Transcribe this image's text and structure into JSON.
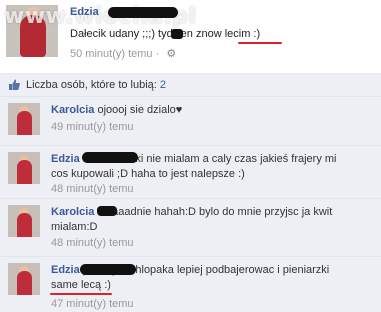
{
  "watermark": "www.wiocha.pl",
  "post": {
    "author": "Edzia",
    "text_visible": "Dałecik udany ;;;) ",
    "text_tail": "tydzien znow ",
    "text_emph": "lecim",
    "text_end": " :)",
    "time": "50 minut(y) temu",
    "separator": "·",
    "gear_icon": "gear-icon"
  },
  "likes": {
    "label": "Liczba osób, które to lubią: ",
    "count": "2",
    "icon": "thumbs-up-icon"
  },
  "comments": [
    {
      "author": "Karolcia",
      "text": "ojoooj sie dzialo♥",
      "time": "49 minut(y) temu"
    },
    {
      "author": "Edzia",
      "text": "hah zlotówki nie mialam a caly czas jakieś frajery mi cos kupowali ;D haha to jest nalepsze :)",
      "time": "48 minut(y) temu"
    },
    {
      "author": "Karolcia",
      "text": "to laaadnie hahah:D bylo do mnie przyjsc ja kwit mialam:D",
      "time": "48 minut(y) temu"
    },
    {
      "author": "Edzia",
      "text_a": "po co jak chlopaka lepiej podbajerowac i ",
      "text_emph": "pieniarzki",
      "text_b": " same lecą :)",
      "time": "47 minut(y) temu"
    }
  ],
  "colors": {
    "link": "#3b5998",
    "comment_bg": "#edeff4",
    "underline": "#d9242a"
  }
}
